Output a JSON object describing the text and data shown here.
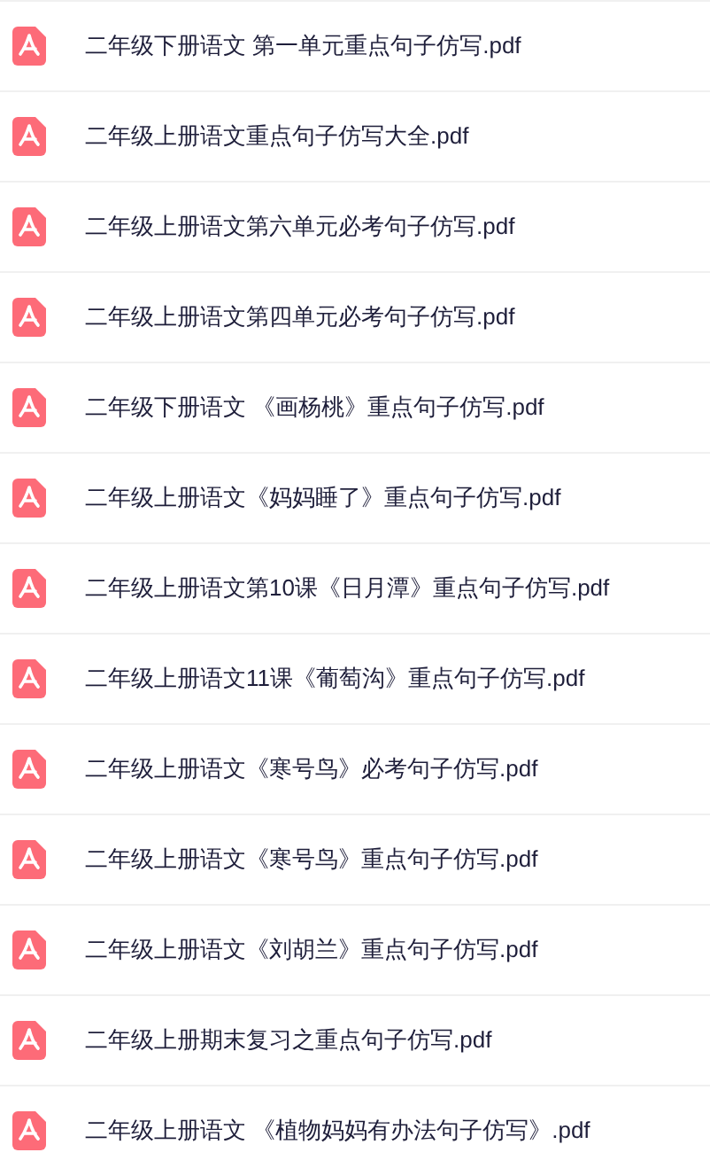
{
  "files": [
    {
      "name": "二年级下册语文 第一单元重点句子仿写.pdf"
    },
    {
      "name": "二年级上册语文重点句子仿写大全.pdf"
    },
    {
      "name": "二年级上册语文第六单元必考句子仿写.pdf"
    },
    {
      "name": "二年级上册语文第四单元必考句子仿写.pdf"
    },
    {
      "name": "二年级下册语文 《画杨桃》重点句子仿写.pdf"
    },
    {
      "name": "二年级上册语文《妈妈睡了》重点句子仿写.pdf"
    },
    {
      "name": "二年级上册语文第10课《日月潭》重点句子仿写.pdf"
    },
    {
      "name": "二年级上册语文11课《葡萄沟》重点句子仿写.pdf"
    },
    {
      "name": "二年级上册语文《寒号鸟》必考句子仿写.pdf"
    },
    {
      "name": "二年级上册语文《寒号鸟》重点句子仿写.pdf"
    },
    {
      "name": "二年级上册语文《刘胡兰》重点句子仿写.pdf"
    },
    {
      "name": "二年级上册期末复习之重点句子仿写.pdf"
    },
    {
      "name": "二年级上册语文 《植物妈妈有办法句子仿写》.pdf"
    }
  ]
}
